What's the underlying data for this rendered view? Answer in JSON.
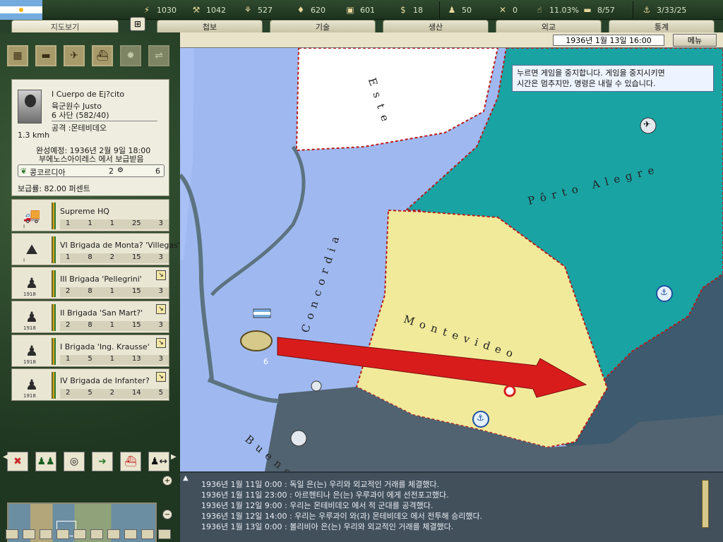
{
  "resources": [
    {
      "icon": "energy-icon",
      "glyph": "⚡",
      "value": "1030"
    },
    {
      "icon": "metal-icon",
      "glyph": "⚒",
      "value": "1042"
    },
    {
      "icon": "rare-materials-icon",
      "glyph": "⚘",
      "value": "527"
    },
    {
      "icon": "oil-icon",
      "glyph": "♦",
      "value": "620"
    },
    {
      "icon": "supplies-icon",
      "glyph": "▣",
      "value": "601"
    },
    {
      "icon": "money-icon",
      "glyph": "$",
      "value": "18"
    },
    {
      "icon": "manpower-icon",
      "glyph": "♟",
      "value": "50"
    },
    {
      "icon": "diplomacy-icon",
      "glyph": "✕",
      "value": "0"
    },
    {
      "icon": "dissent-icon",
      "glyph": "☝",
      "value": "11.03%"
    },
    {
      "icon": "transport-icon",
      "glyph": "▬",
      "value": "8/57"
    },
    {
      "icon": "convoy-icon",
      "glyph": "⚓",
      "value": "3/33/25"
    }
  ],
  "tabs": [
    "지도보기",
    "첩보",
    "기술",
    "생산",
    "외교",
    "통계"
  ],
  "datetime": "1936년 1월 13일 16:00",
  "menu_label": "메뉴",
  "tooltip": {
    "line1": "누르면 게임을 중지합니다. 게임을 중지시키면",
    "line2": "시간은 멈추지만, 명령은 내릴 수 있습니다."
  },
  "unit": {
    "name": "I Cuerpo de Ej?cito",
    "commander": "육군원수 Justo",
    "divisions": "6 사단 (582/40)",
    "mission": "공격 :몬테비데오",
    "speed": "1.3 kmh",
    "completion": "완성예정: 1936년 2월 9일 18:00",
    "supply_from": "부에노스아이레스 에서 보급받음",
    "supply_base": "콩코르디아",
    "supply_count_a": "2",
    "supply_count_b": "6",
    "supply_rate": "보급률: 82.00 퍼센트"
  },
  "unit_rows": [
    {
      "name": "Supreme HQ",
      "stats": [
        "1",
        "1",
        "1",
        "25",
        "3"
      ],
      "icon": "hq-truck-icon",
      "glyph": "🚚",
      "level": "I"
    },
    {
      "name": "VI Brigada de Monta? 'Villegas'",
      "stats": [
        "1",
        "8",
        "2",
        "15",
        "3"
      ],
      "icon": "mountain-infantry-icon",
      "glyph": "⛰",
      "level": "I"
    },
    {
      "name": "III Brigada 'Pellegrini'",
      "stats": [
        "2",
        "8",
        "1",
        "15",
        "3"
      ],
      "icon": "infantry-icon",
      "glyph": "♟",
      "level": "1918"
    },
    {
      "name": "II Brigada 'San Mart?'",
      "stats": [
        "2",
        "8",
        "1",
        "15",
        "3"
      ],
      "icon": "infantry-icon",
      "glyph": "♟",
      "level": "1918"
    },
    {
      "name": "I Brigada 'Ing. Krausse'",
      "stats": [
        "1",
        "5",
        "1",
        "13",
        "3"
      ],
      "icon": "infantry-icon",
      "glyph": "♟",
      "level": "1918"
    },
    {
      "name": "IV Brigada de Infanter?",
      "stats": [
        "2",
        "5",
        "2",
        "14",
        "5"
      ],
      "icon": "infantry-icon",
      "glyph": "♟",
      "level": "1918"
    }
  ],
  "map_labels": {
    "este": "Este",
    "concordia": "Concordia",
    "porto_alegre": "Pôrto Alegre",
    "montevideo": "Montevideo",
    "buenos": "Buenos",
    "unit_count": "6"
  },
  "log": [
    "1936년 1월 11일 0:00  : 독일 은(는) 우리와 외교적인 거래를 체결했다.",
    "1936년 1월 11일 23:00  : 아르헨티나 은(는) 우루과이 에게 선전포고했다.",
    "1936년 1월 12일 9:00  : 우리는 몬테비데오 에서 적 군대를 공격했다.",
    "1936년 1월 12일 14:00  : 우리는 우루과이 와(과) 몬테비데오 에서 전투해 승리했다.",
    "1936년 1월 13일 0:00  : 볼리비아 은(는) 우리와 외교적인 거래를 체결했다."
  ],
  "colors": {
    "sea": "#9fb9f0",
    "land_green": "#1aa3a3",
    "montevideo": "#f1ea9a",
    "border_red": "#c62828",
    "attack_arrow": "#d81c1c"
  }
}
